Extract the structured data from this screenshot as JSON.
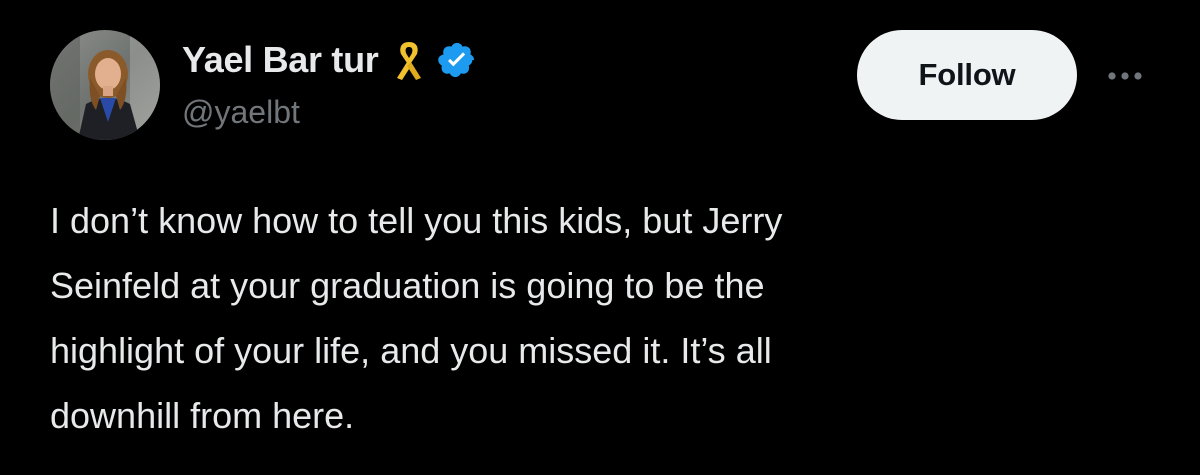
{
  "tweet": {
    "author": {
      "display_name": "Yael Bar tur",
      "handle": "@yaelbt",
      "badges": {
        "ribbon_icon": "yellow-ribbon-icon",
        "ribbon_color": "#f2c12e",
        "verified_icon": "verified-badge-icon",
        "verified_color": "#1d9bf0"
      },
      "avatar_icon": "avatar"
    },
    "follow_label": "Follow",
    "more_icon": "more-options-icon",
    "text_lines": [
      "I don’t know how to tell you this kids, but Jerry",
      "Seinfeld at your graduation is going to be the",
      "highlight of your life, and you missed it. It’s all",
      "downhill from here."
    ]
  },
  "colors": {
    "background": "#000000",
    "primary_text": "#e7e9ea",
    "secondary_text": "#71767b",
    "button_bg": "#eff3f4",
    "button_text": "#0f1419"
  }
}
